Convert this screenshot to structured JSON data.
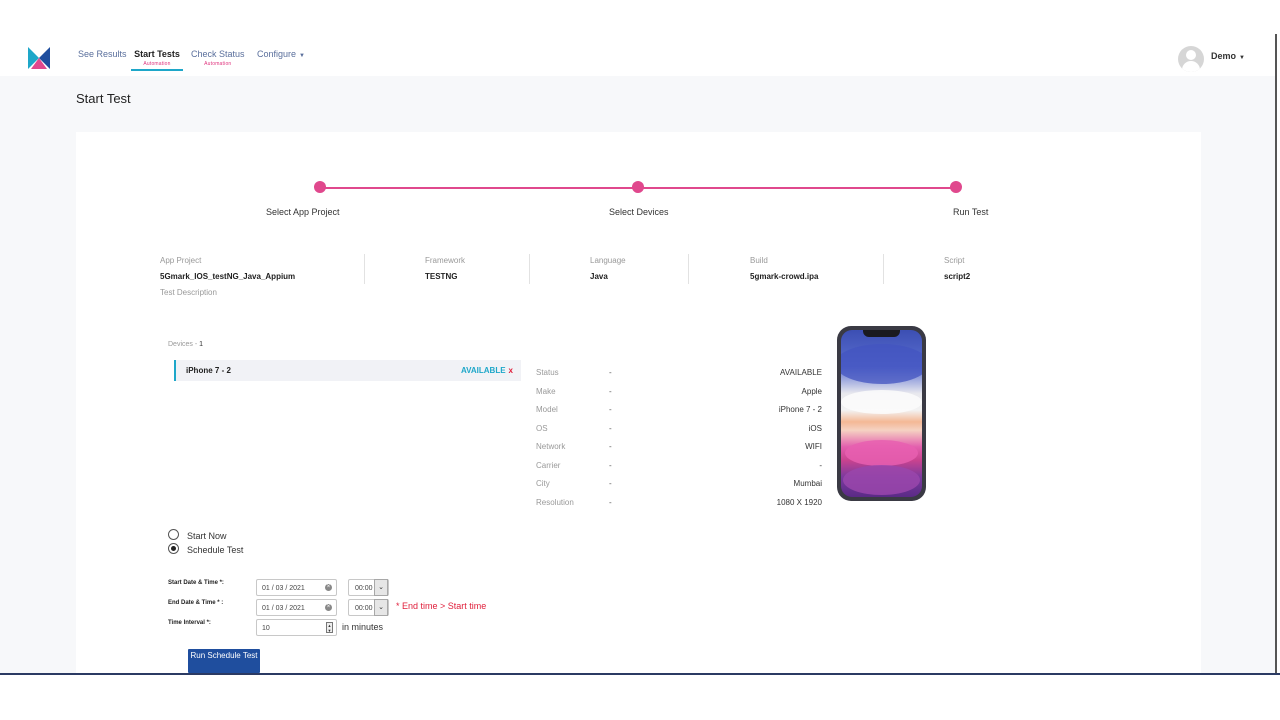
{
  "nav": {
    "items": [
      {
        "label": "See Results",
        "sub": ""
      },
      {
        "label": "Start Tests",
        "sub": "Automation"
      },
      {
        "label": "Check Status",
        "sub": "Automation"
      },
      {
        "label": "Configure",
        "sub": ""
      }
    ],
    "user": "Demo",
    "brand_colors": {
      "accent": "#e0488d",
      "teal": "#1ea7c9",
      "navy": "#1f4e9e"
    }
  },
  "page_title": "Start Test",
  "stepper": {
    "steps": [
      "Select App Project",
      "Select Devices",
      "Run Test"
    ]
  },
  "project_info": [
    {
      "label": "App Project",
      "value": "5Gmark_IOS_testNG_Java_Appium"
    },
    {
      "label": "Framework",
      "value": "TESTNG"
    },
    {
      "label": "Language",
      "value": "Java"
    },
    {
      "label": "Build",
      "value": "5gmark-crowd.ipa"
    },
    {
      "label": "Script",
      "value": "script2"
    }
  ],
  "test_description_label": "Test Description",
  "devices": {
    "count_label": "Devices - ",
    "count": "1",
    "list": [
      {
        "name": "iPhone 7 - 2",
        "status": "AVAILABLE",
        "remove": "x"
      }
    ]
  },
  "device_details": [
    {
      "label": "Status",
      "dash": "-",
      "value": "AVAILABLE"
    },
    {
      "label": "Make",
      "dash": "-",
      "value": "Apple"
    },
    {
      "label": "Model",
      "dash": "-",
      "value": "iPhone 7 - 2"
    },
    {
      "label": "OS",
      "dash": "-",
      "value": "iOS"
    },
    {
      "label": "Network",
      "dash": "-",
      "value": "WIFI"
    },
    {
      "label": "Carrier",
      "dash": "-",
      "value": "-"
    },
    {
      "label": "City",
      "dash": "-",
      "value": "Mumbai"
    },
    {
      "label": "Resolution",
      "dash": "-",
      "value": "1080 X 1920"
    }
  ],
  "schedule": {
    "start_now": "Start Now",
    "schedule_test": "Schedule Test",
    "selected": "schedule_test",
    "start_label": "Start Date & Time *:",
    "end_label": "End Date & Time * :",
    "interval_label": "Time Interval *:",
    "start_date": "01 / 03 / 2021",
    "start_time": "00:00",
    "end_date": "01 / 03 / 2021",
    "end_time": "00:00",
    "interval": "10",
    "interval_unit": "in minutes",
    "error": "* End time > Start time",
    "run_button": "Run Schedule Test"
  }
}
